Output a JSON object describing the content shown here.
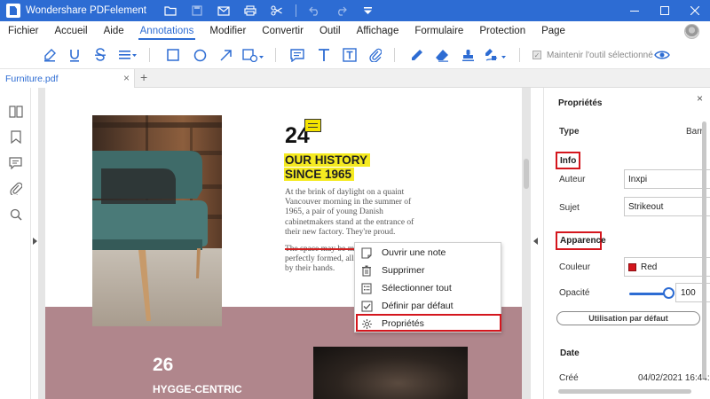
{
  "app": {
    "title": "Wondershare PDFelement",
    "icons": [
      "folder-icon",
      "save-icon",
      "mail-icon",
      "print-icon",
      "scissors-icon",
      "undo-icon",
      "redo-icon",
      "quick-access-icon"
    ]
  },
  "menu": {
    "items": [
      "Fichier",
      "Accueil",
      "Aide",
      "Annotations",
      "Modifier",
      "Convertir",
      "Outil",
      "Affichage",
      "Formulaire",
      "Protection",
      "Page"
    ],
    "active": "Annotations"
  },
  "toolbar": {
    "tools": [
      "highlight-icon",
      "underline-icon",
      "strikethrough-icon",
      "lines-icon",
      "rectangle-icon",
      "ellipse-icon",
      "arrow-icon",
      "shape-dropdown-icon",
      "comment-icon",
      "text-icon",
      "textbox-icon",
      "attachment-icon",
      "pencil-icon",
      "eraser-icon",
      "stamp-icon",
      "signature-icon"
    ],
    "keep_tool_label": "Maintenir l'outil sélectionné",
    "keep_tool_checked": true
  },
  "tabs": {
    "document": "Furniture.pdf",
    "close": "×",
    "new": "+"
  },
  "sidebar": {
    "icons": [
      "thumbnails-icon",
      "bookmark-icon",
      "comments-icon",
      "attachments-icon",
      "search-icon"
    ]
  },
  "document": {
    "number": "24",
    "heading_line1": "OUR HISTORY",
    "heading_line2": "SINCE 1965",
    "paragraph": "At the brink of daylight on a quaint Vancouver morning in the summer of 1965, a pair of young Danish cabinetmakers stand at the entrance of their new factory. They're proud.",
    "strikeout_text": "The space may be mode",
    "paragraph_rest1": "perfectly formed, all ",
    "paragraph_rest2": "by their hands.",
    "number2": "26",
    "heading2": "HYGGE-CENTRIC"
  },
  "context_menu": {
    "items": [
      {
        "label": "Ouvrir une note",
        "icon": "note-icon"
      },
      {
        "label": "Supprimer",
        "icon": "trash-icon"
      },
      {
        "label": "Sélectionner tout",
        "icon": "select-all-icon"
      },
      {
        "label": "Définir par défaut",
        "icon": "checkbox-icon"
      },
      {
        "label": "Propriétés",
        "icon": "gear-icon"
      }
    ],
    "highlighted": "Propriétés"
  },
  "properties": {
    "title": "Propriétés",
    "close": "×",
    "type_label": "Type",
    "type_value": "Barr",
    "info_section": "Info",
    "author_label": "Auteur",
    "author_value": "Inxpi",
    "subject_label": "Sujet",
    "subject_value": "Strikeout",
    "appearance_section": "Apparence",
    "color_label": "Couleur",
    "color_value": "Red",
    "color_hex": "#d4161d",
    "opacity_label": "Opacité",
    "opacity_value": "100",
    "opacity_fraction": 1.0,
    "default_button": "Utilisation par défaut",
    "date_section": "Date",
    "created_label": "Créé",
    "created_value": "04/02/2021 16:44:"
  },
  "colors": {
    "brand": "#2d6cd3",
    "highlight_red": "#d4161d",
    "annotation_yellow": "#f5ea20"
  }
}
